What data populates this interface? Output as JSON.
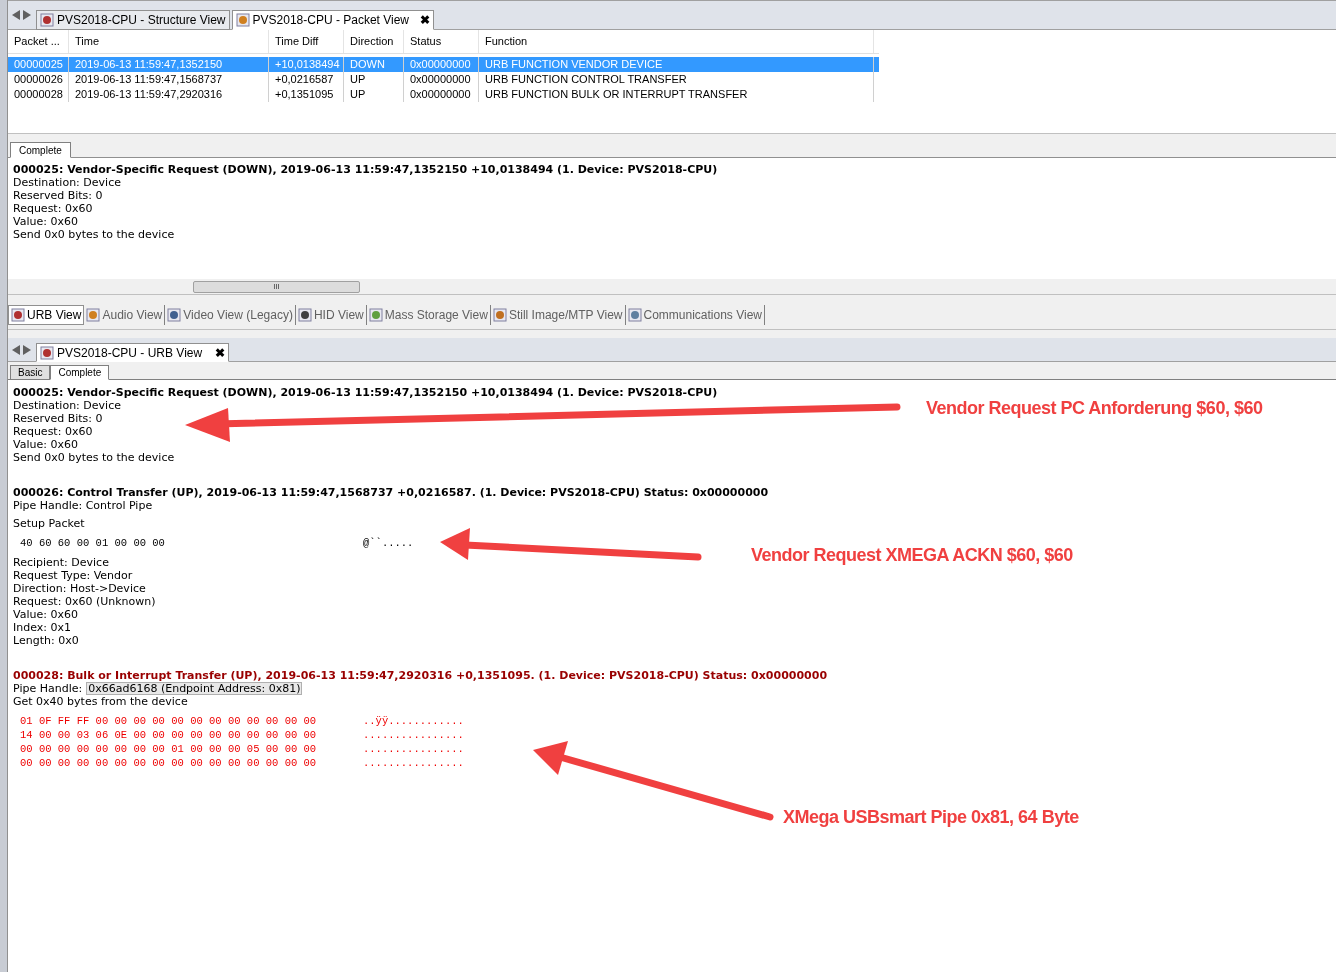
{
  "top_tabs": [
    {
      "label": "PVS2018-CPU - Structure View",
      "selected": false
    },
    {
      "label": "PVS2018-CPU - Packet View",
      "selected": true
    }
  ],
  "close_glyph": "✖",
  "packet_table": {
    "columns": [
      "Packet ...",
      "Time",
      "Time Diff",
      "Direction",
      "Status",
      "Function"
    ],
    "rows": [
      {
        "cells": [
          "00000025",
          "2019-06-13 11:59:47,1352150",
          "+10,0138494",
          "DOWN",
          "0x00000000",
          "URB FUNCTION VENDOR DEVICE"
        ],
        "selected": true
      },
      {
        "cells": [
          "00000026",
          "2019-06-13 11:59:47,1568737",
          "+0,0216587",
          "UP",
          "0x00000000",
          "URB FUNCTION CONTROL TRANSFER"
        ],
        "selected": false
      },
      {
        "cells": [
          "00000028",
          "2019-06-13 11:59:47,2920316",
          "+0,1351095",
          "UP",
          "0x00000000",
          "URB FUNCTION BULK OR INTERRUPT TRANSFER"
        ],
        "selected": false
      }
    ]
  },
  "packet_detail": {
    "tabs": [
      {
        "label": "Complete",
        "selected": true
      }
    ],
    "header": "000025: Vendor-Specific Request (DOWN), 2019-06-13 11:59:47,1352150 +10,0138494 (1. Device: PVS2018-CPU)",
    "lines": [
      "Destination: Device",
      "Reserved Bits: 0",
      "Request: 0x60",
      "Value: 0x60",
      "Send 0x0 bytes to the device"
    ],
    "scroll_grip": "III"
  },
  "view_tabs": [
    {
      "label": "URB View",
      "selected": true
    },
    {
      "label": "Audio View",
      "selected": false
    },
    {
      "label": "Video View (Legacy)",
      "selected": false
    },
    {
      "label": "HID View",
      "selected": false
    },
    {
      "label": "Mass Storage View",
      "selected": false
    },
    {
      "label": "Still Image/MTP View",
      "selected": false
    },
    {
      "label": "Communications View",
      "selected": false
    }
  ],
  "urb_view": {
    "title": "PVS2018-CPU - URB View",
    "close_glyph": "✖",
    "tabs": [
      {
        "label": "Basic",
        "selected": false
      },
      {
        "label": "Complete",
        "selected": true
      }
    ],
    "records": [
      {
        "header": "000025: Vendor-Specific Request (DOWN), 2019-06-13 11:59:47,1352150 +10,0138494 (1. Device: PVS2018-CPU)",
        "error": false,
        "blocks": [
          {
            "kind": "lines",
            "lines": [
              "Destination: Device",
              "Reserved Bits: 0",
              "Request: 0x60",
              "Value: 0x60",
              "Send 0x0 bytes to the device"
            ]
          }
        ]
      },
      {
        "header": "000026: Control Transfer (UP), 2019-06-13 11:59:47,1568737 +0,0216587. (1. Device: PVS2018-CPU) Status: 0x00000000",
        "error": false,
        "blocks": [
          {
            "kind": "lines",
            "lines": [
              "Pipe Handle: Control Pipe"
            ]
          },
          {
            "kind": "lines",
            "lines": [
              "Setup Packet"
            ]
          },
          {
            "kind": "hex",
            "rows": [
              {
                "bytes": "40 60 60 00 01 00 00 00",
                "ascii": "@``....."
              }
            ]
          },
          {
            "kind": "lines",
            "lines": [
              "Recipient: Device",
              "Request Type: Vendor",
              "Direction: Host->Device",
              "Request: 0x60 (Unknown)",
              "Value: 0x60",
              "Index: 0x1",
              "Length: 0x0"
            ]
          }
        ]
      },
      {
        "header": "000028: Bulk or Interrupt Transfer (UP), 2019-06-13 11:59:47,2920316 +0,1351095. (1. Device: PVS2018-CPU) Status: 0x00000000",
        "error": true,
        "blocks": [
          {
            "kind": "field",
            "label": "Pipe Handle:",
            "value": "0x66ad6168 (Endpoint Address: 0x81)"
          },
          {
            "kind": "lines",
            "lines": [
              "Get 0x40 bytes from the device"
            ]
          },
          {
            "kind": "hex",
            "rows": [
              {
                "bytes": "01 0F FF FF 00 00 00 00 00 00 00 00 00 00 00 00",
                "ascii": "..ÿÿ............"
              },
              {
                "bytes": "14 00 00 03 06 0E 00 00 00 00 00 00 00 00 00 00",
                "ascii": "................"
              },
              {
                "bytes": "00 00 00 00 00 00 00 00 01 00 00 00 05 00 00 00",
                "ascii": "................"
              },
              {
                "bytes": "00 00 00 00 00 00 00 00 00 00 00 00 00 00 00 00",
                "ascii": "................"
              }
            ]
          }
        ]
      }
    ]
  },
  "annotations": [
    {
      "text": "Vendor Request PC Anforderung $60, $60"
    },
    {
      "text": "Vendor Request XMEGA ACKN  $60, $60"
    },
    {
      "text": "XMega USBsmart Pipe 0x81, 64 Byte"
    }
  ]
}
